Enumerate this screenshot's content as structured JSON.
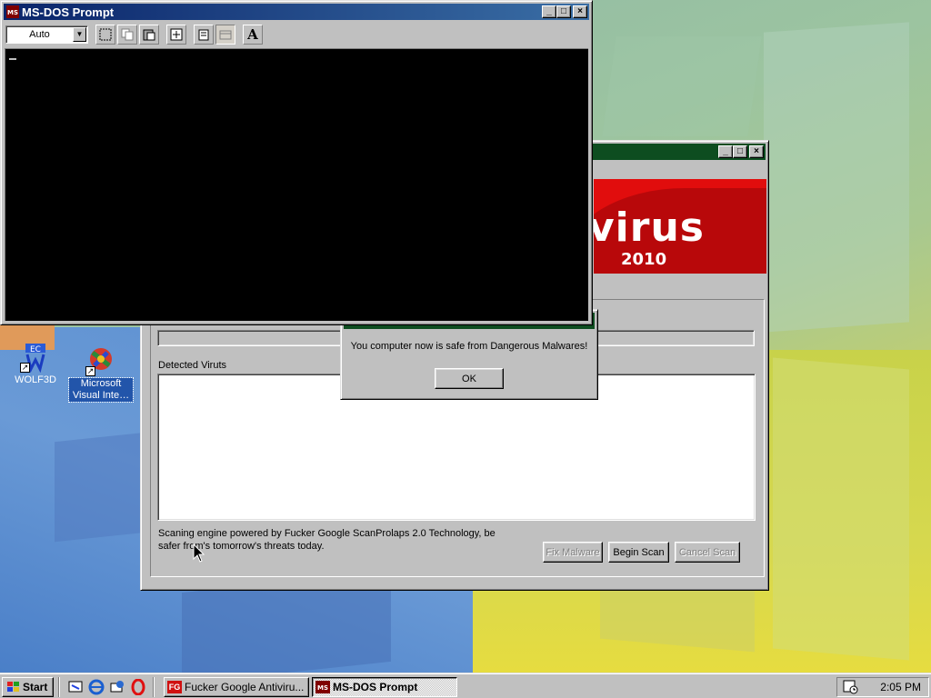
{
  "desktop": {
    "icons": [
      {
        "label": "WOLF3D",
        "icon": "wolf3d-icon"
      },
      {
        "label": "Microsoft Visual Inte…",
        "icon": "visual-interdev-icon"
      }
    ]
  },
  "dos_window": {
    "title": "MS-DOS Prompt",
    "font_size_select": "Auto",
    "toolbar_icons": [
      "mark-icon",
      "copy-icon",
      "paste-icon",
      "fullscreen-icon",
      "properties-icon",
      "background-icon",
      "font-icon"
    ],
    "font_button": "A"
  },
  "antivirus_window": {
    "banner_text": "virus",
    "banner_year": "2010",
    "detected_label": "Detected Viruts",
    "engine_text": "Scaning engine powered by Fucker Google ScanProlaps 2.0 Technology, be safer from's tomorrow's threats today.",
    "buttons": {
      "fix": "Fix Malware",
      "begin": "Begin Scan",
      "cancel": "Cancel Scan"
    }
  },
  "message_box": {
    "text": "You computer now is safe from Dangerous Malwares!",
    "ok": "OK"
  },
  "taskbar": {
    "start": "Start",
    "tasks": [
      {
        "label": "Fucker Google Antiviru...",
        "active": false
      },
      {
        "label": "MS-DOS Prompt",
        "active": true
      }
    ],
    "clock": "2:05 PM"
  },
  "colors": {
    "titlebar_active": "#0a246a",
    "titlebar_inactive": "#0d4d20",
    "banner_red": "#e10d0d",
    "face": "#c0c0c0"
  }
}
